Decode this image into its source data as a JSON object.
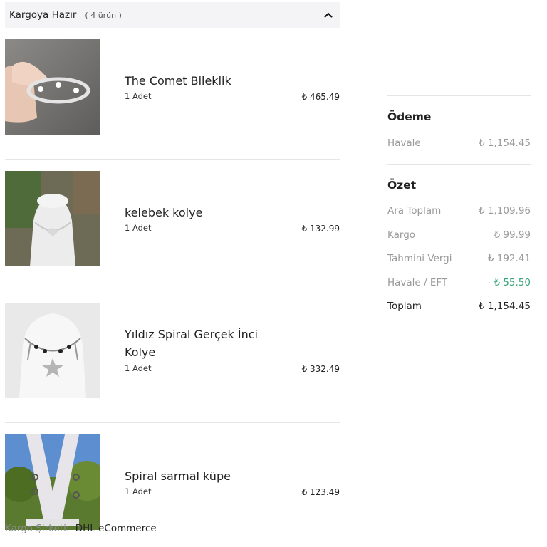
{
  "shipment": {
    "title": "Kargoya Hazır",
    "count": "( 4 ürün )"
  },
  "items": [
    {
      "name": "The Comet Bileklik",
      "qty": "1 Adet",
      "price": "₺ 465.49"
    },
    {
      "name": "kelebek kolye",
      "qty": "1 Adet",
      "price": "₺ 132.99"
    },
    {
      "name": "Yıldız Spiral Gerçek İnci Kolye",
      "qty": "1 Adet",
      "price": "₺ 332.49"
    },
    {
      "name": "Spiral sarmal küpe",
      "qty": "1 Adet",
      "price": "₺ 123.49"
    }
  ],
  "carrier": {
    "label": "Kargo Şirketi:",
    "value": "DHL eCommerce"
  },
  "payment": {
    "title": "Ödeme",
    "method": "Havale",
    "amount": "₺ 1,154.45"
  },
  "summary": {
    "title": "Özet",
    "rows": [
      {
        "label": "Ara Toplam",
        "value": "₺ 1,109.96"
      },
      {
        "label": "Kargo",
        "value": "₺ 99.99"
      },
      {
        "label": "Tahmini Vergi",
        "value": "₺ 192.41"
      },
      {
        "label": "Havale / EFT",
        "value": "- ₺ 55.50"
      }
    ],
    "total_label": "Toplam",
    "total_value": "₺ 1,154.45"
  },
  "colors": {
    "header_bg": "#f4f4f6",
    "discount": "#3aa579",
    "muted": "#9a9a9a"
  }
}
